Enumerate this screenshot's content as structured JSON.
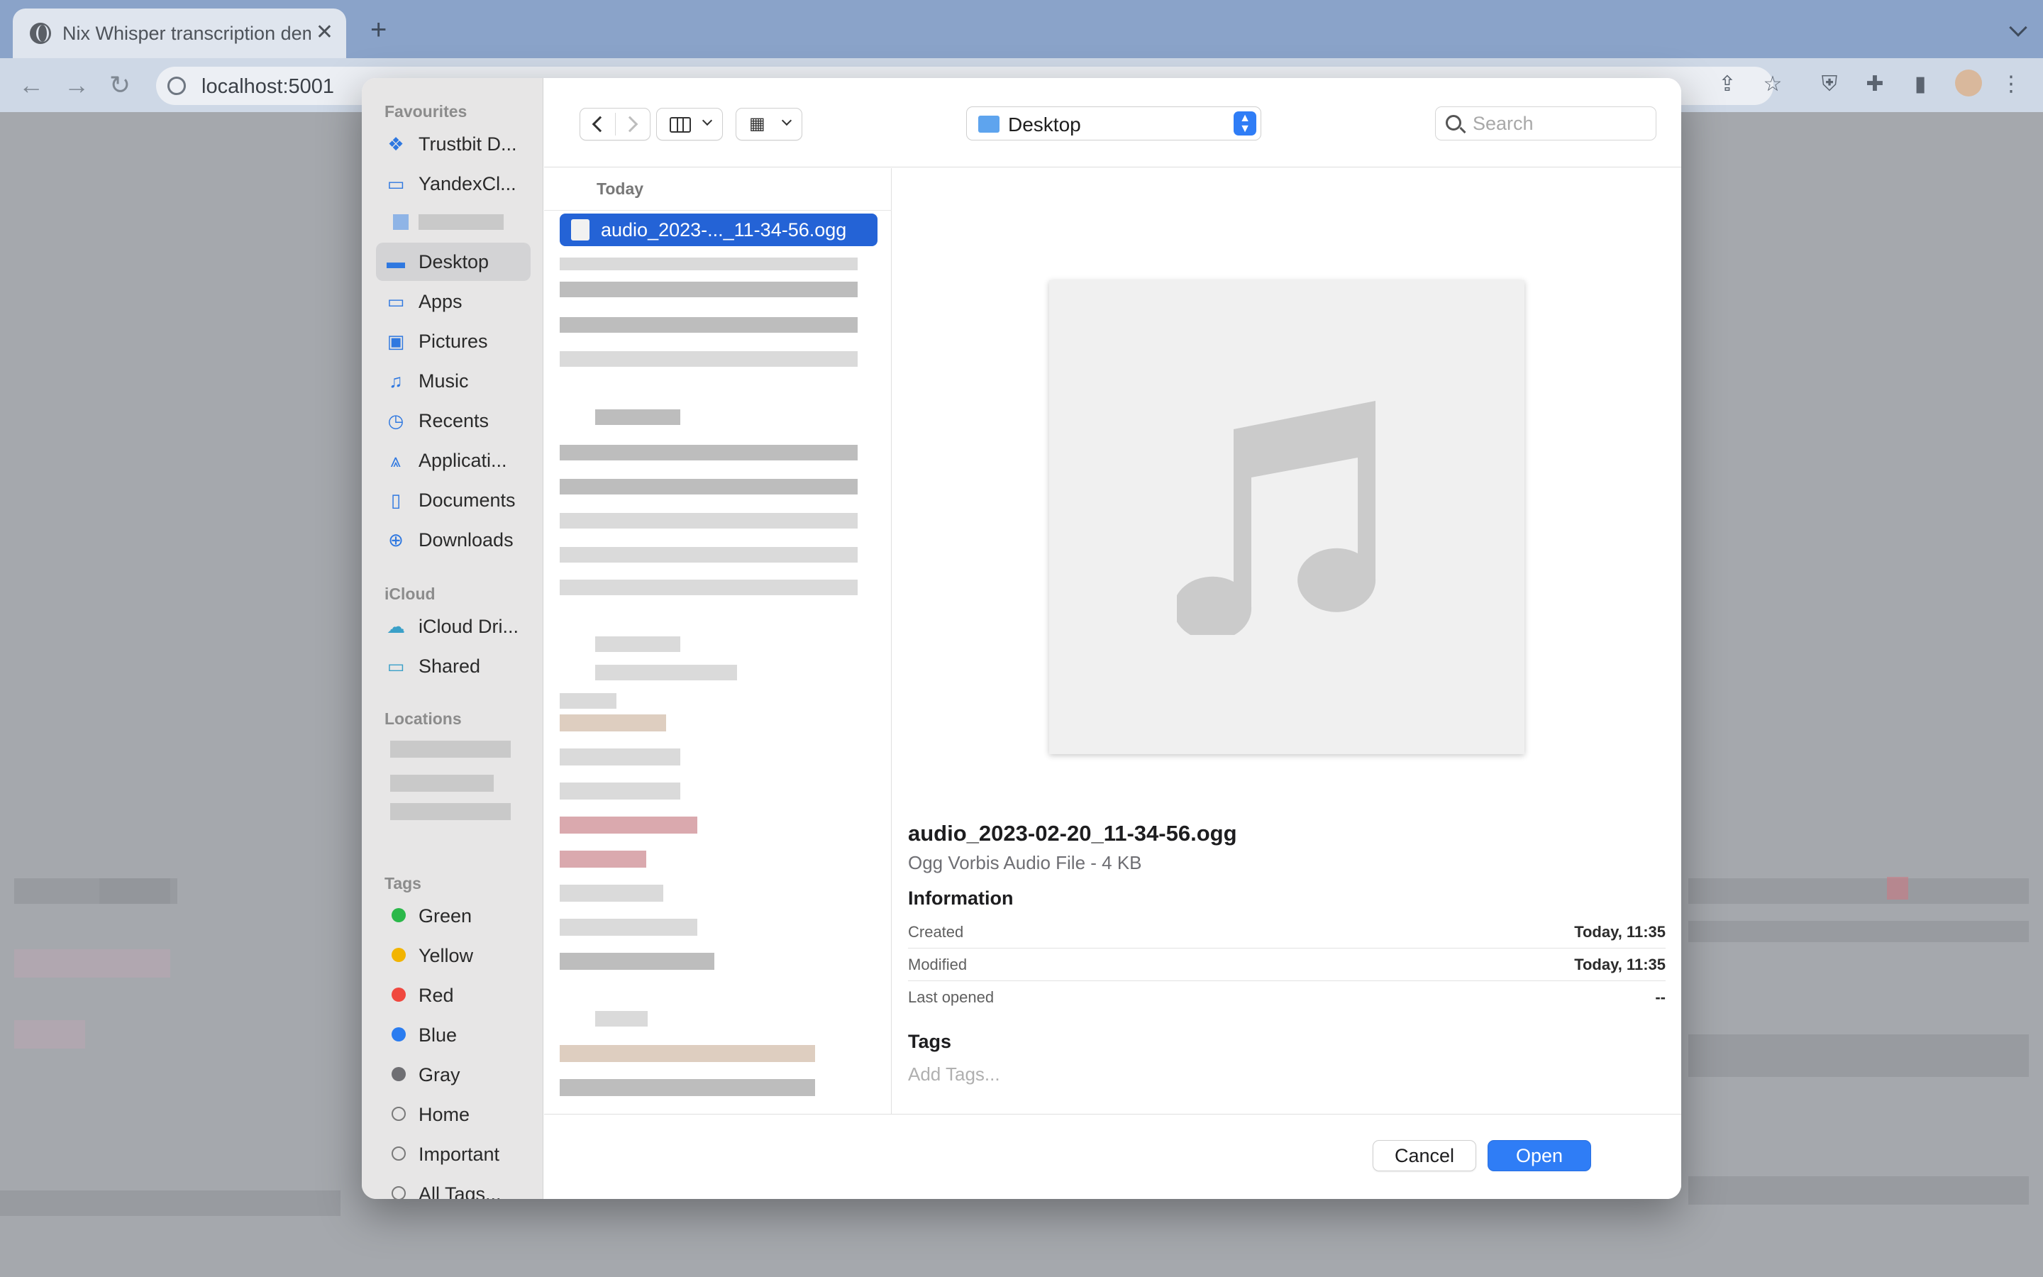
{
  "browser": {
    "tab_title": "Nix Whisper transcription demo",
    "tab_close": "✕",
    "new_tab": "+",
    "url": "localhost:5001"
  },
  "sidebar": {
    "favourites_header": "Favourites",
    "favourites": [
      {
        "label": "Trustbit D...",
        "icon": "dropbox-icon"
      },
      {
        "label": "YandexCl...",
        "icon": "folder-icon"
      },
      {
        "label": "Desktop",
        "icon": "desktop-icon",
        "selected": true
      },
      {
        "label": "Apps",
        "icon": "folder-icon"
      },
      {
        "label": "Pictures",
        "icon": "photo-icon"
      },
      {
        "label": "Music",
        "icon": "music-note-icon"
      },
      {
        "label": "Recents",
        "icon": "clock-icon"
      },
      {
        "label": "Applicati...",
        "icon": "applications-icon"
      },
      {
        "label": "Documents",
        "icon": "document-icon"
      },
      {
        "label": "Downloads",
        "icon": "download-icon"
      }
    ],
    "icloud_header": "iCloud",
    "icloud": [
      {
        "label": "iCloud Dri...",
        "icon": "cloud-icon"
      },
      {
        "label": "Shared",
        "icon": "shared-folder-icon"
      }
    ],
    "locations_header": "Locations",
    "tags_header": "Tags",
    "tags": [
      {
        "label": "Green",
        "color": "#2bb84a"
      },
      {
        "label": "Yellow",
        "color": "#f2b400"
      },
      {
        "label": "Red",
        "color": "#f0483f"
      },
      {
        "label": "Blue",
        "color": "#2a7cf0"
      },
      {
        "label": "Gray",
        "color": "#6f6f73"
      },
      {
        "label": "Home",
        "color": ""
      },
      {
        "label": "Important",
        "color": ""
      },
      {
        "label": "All Tags...",
        "color": ""
      }
    ]
  },
  "topbar": {
    "location": "Desktop",
    "search_placeholder": "Search"
  },
  "file_list": {
    "group_header": "Today",
    "selected_file": "audio_2023-..._11-34-56.ogg"
  },
  "preview": {
    "file_name": "audio_2023-02-20_11-34-56.ogg",
    "file_kind": "Ogg Vorbis Audio File - 4 KB",
    "info_header": "Information",
    "info": [
      {
        "key": "Created",
        "value": "Today, 11:35"
      },
      {
        "key": "Modified",
        "value": "Today, 11:35"
      },
      {
        "key": "Last opened",
        "value": "--"
      }
    ],
    "tags_header": "Tags",
    "tags_placeholder": "Add Tags..."
  },
  "footer": {
    "cancel": "Cancel",
    "open": "Open"
  },
  "colors": {
    "accent": "#2f7df6",
    "selection": "#2463d6"
  }
}
